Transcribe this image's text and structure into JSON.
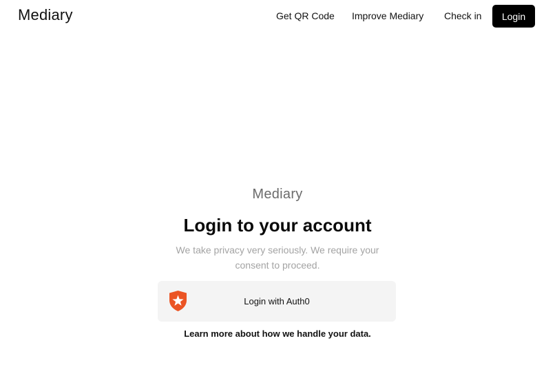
{
  "header": {
    "brand": "Mediary",
    "nav": {
      "qr_label": "Get QR Code",
      "improve_label": "Improve Mediary",
      "checkin_label": "Check in"
    },
    "login_label": "Login"
  },
  "login_panel": {
    "brand": "Mediary",
    "title": "Login to your account",
    "subtitle": "We take privacy very seriously. We require your consent to proceed.",
    "auth_button_label": "Login with Auth0",
    "auth_icon": "auth0-shield-icon",
    "learn_more": "Learn more about how we handle your data."
  },
  "colors": {
    "login_button_bg": "#000000",
    "auth_button_bg": "#f4f4f4",
    "auth0_brand": "#eb5424",
    "subtitle_text": "#a3a3a3"
  }
}
